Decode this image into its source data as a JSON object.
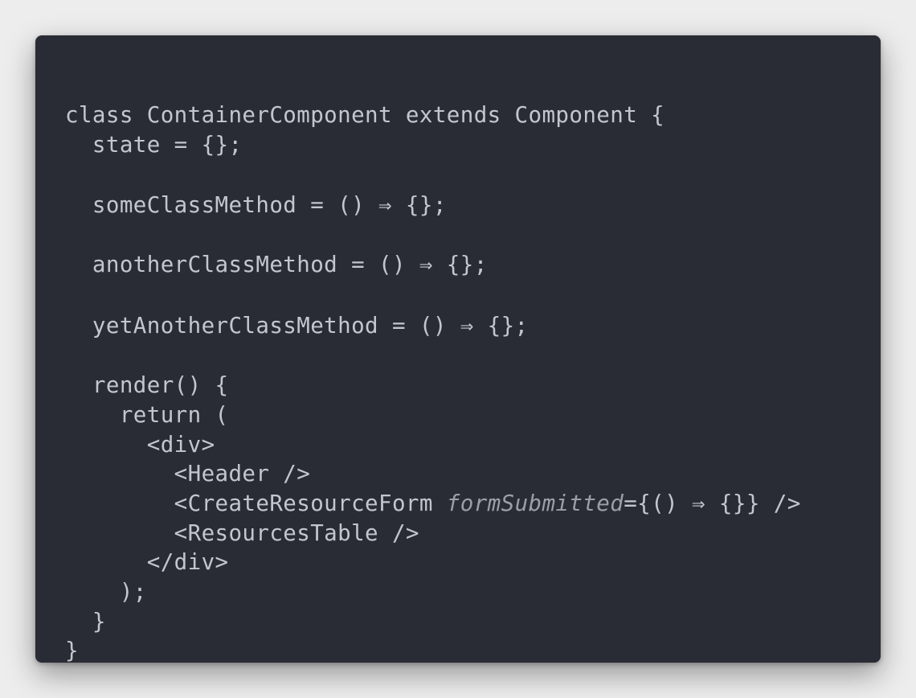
{
  "code": {
    "lines": [
      "class ContainerComponent extends Component {",
      "  state = {};",
      "",
      "  someClassMethod = () ⇒ {};",
      "",
      "  anotherClassMethod = () ⇒ {};",
      "",
      "  yetAnotherClassMethod = () ⇒ {};",
      "",
      "  render() {",
      "    return (",
      "      <div>",
      "        <Header />",
      "        <CreateResourceForm ",
      "formSubmitted",
      "={() ⇒ {}} />",
      "        <ResourcesTable />",
      "      </div>",
      "    );",
      "  }",
      "}"
    ]
  },
  "colors": {
    "background": "#ededed",
    "editor_background": "#292c35",
    "text": "#c3c6cd",
    "attribute": "#9b9fa7"
  }
}
